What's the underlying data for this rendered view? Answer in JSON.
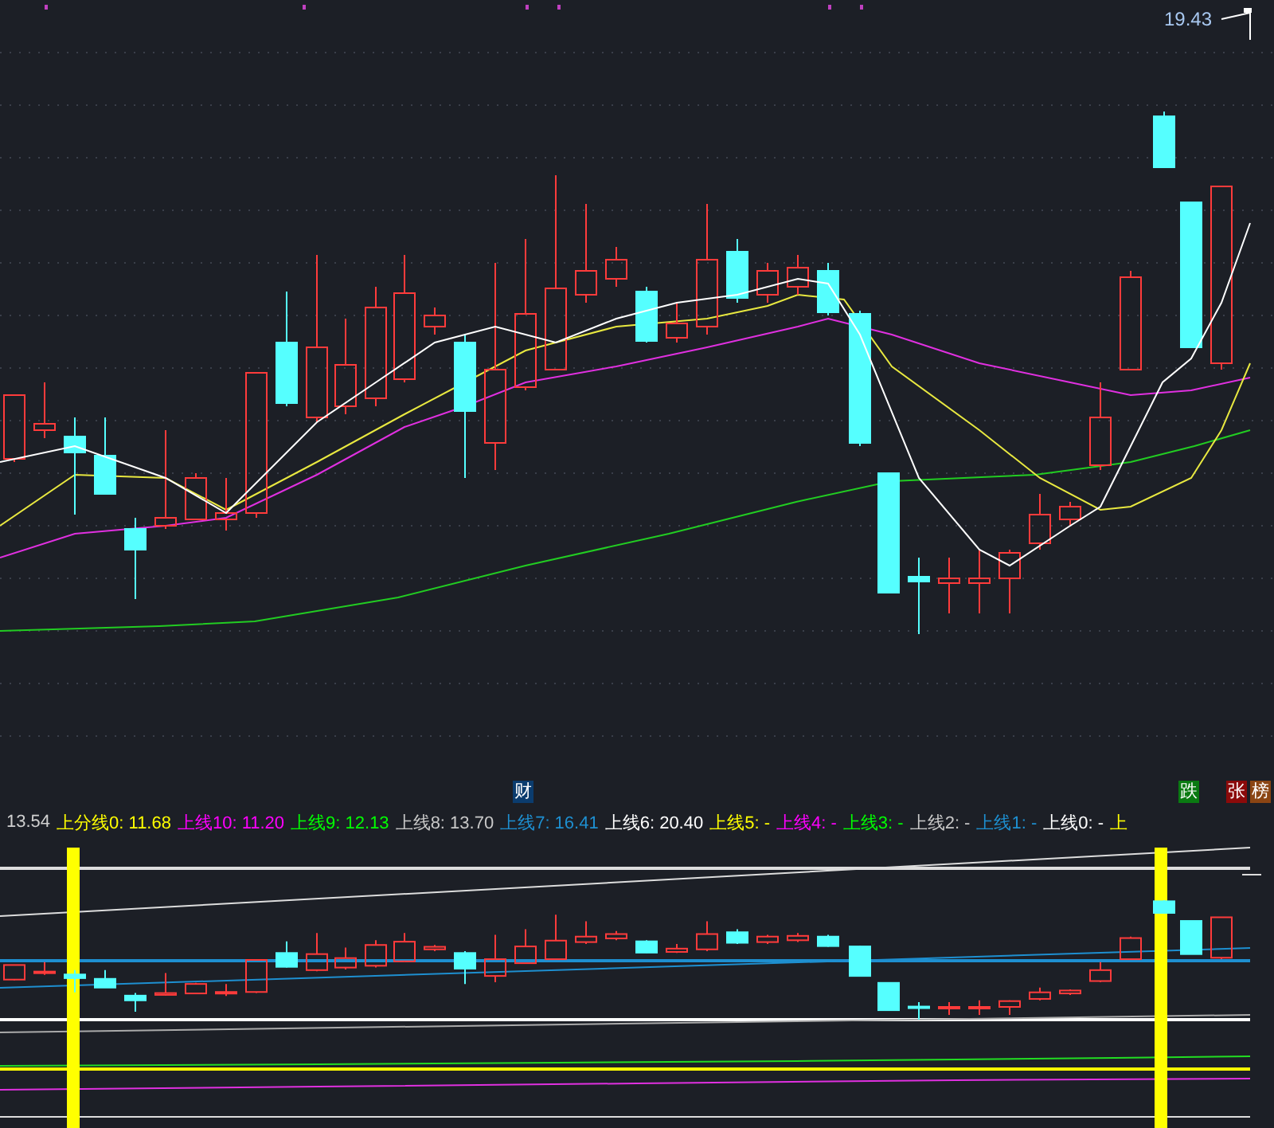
{
  "price_marker": {
    "text": "19.43"
  },
  "tags": [
    {
      "text": "财",
      "color": "#0b3c6e"
    },
    {
      "text": "跌",
      "color": "#0a7a12"
    },
    {
      "text": "张",
      "color": "#8b0a0a"
    },
    {
      "text": "榜",
      "color": "#8b4513"
    }
  ],
  "legend": [
    {
      "text": "13.54",
      "color": "#d0d0d0"
    },
    {
      "text": "上分线0: 11.68",
      "color": "#ffff00"
    },
    {
      "text": "上线10: 11.20",
      "color": "#ff00ff"
    },
    {
      "text": "上线9: 12.13",
      "color": "#00ff00"
    },
    {
      "text": "上线8: 13.70",
      "color": "#c8c8c8"
    },
    {
      "text": "上线7: 16.41",
      "color": "#1e8fd0"
    },
    {
      "text": "上线6: 20.40",
      "color": "#ffffff"
    },
    {
      "text": "上线5: -",
      "color": "#ffff00"
    },
    {
      "text": "上线4: -",
      "color": "#ff00ff"
    },
    {
      "text": "上线3: -",
      "color": "#00ff00"
    },
    {
      "text": "上线2: -",
      "color": "#c8c8c8"
    },
    {
      "text": "上线1: -",
      "color": "#1e8fd0"
    },
    {
      "text": "上线0: -",
      "color": "#ffffff"
    },
    {
      "text": "上",
      "color": "#ffff00"
    }
  ]
}
